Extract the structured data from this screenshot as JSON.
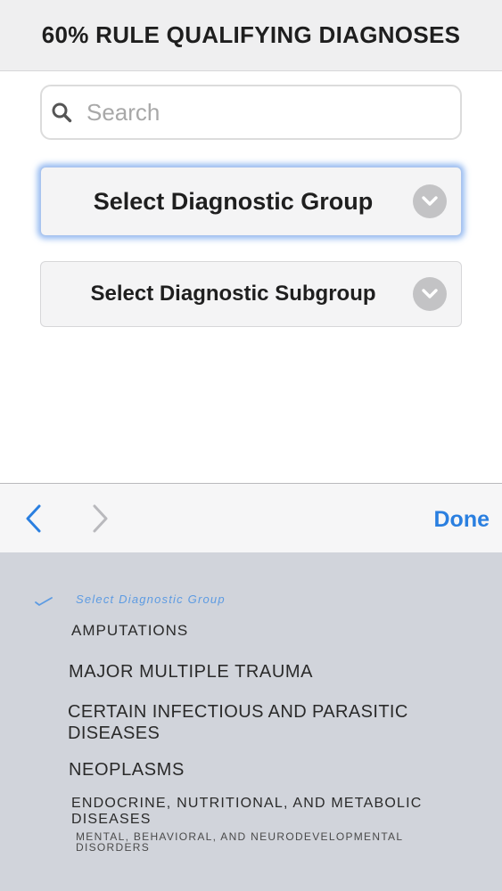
{
  "header": {
    "title": "60% RULE QUALIFYING DIAGNOSES"
  },
  "search": {
    "placeholder": "Search",
    "value": ""
  },
  "group_select": {
    "label": "Select Diagnostic Group"
  },
  "subgroup_select": {
    "label": "Select Diagnostic Subgroup"
  },
  "toolbar": {
    "done_label": "Done"
  },
  "picker": {
    "selected": "Select Diagnostic Group",
    "options": [
      "AMPUTATIONS",
      "MAJOR MULTIPLE TRAUMA",
      "CERTAIN INFECTIOUS AND PARASITIC DISEASES",
      "NEOPLASMS",
      "ENDOCRINE, NUTRITIONAL, AND METABOLIC DISEASES",
      "MENTAL, BEHAVIORAL, AND NEURODEVELOPMENTAL DISORDERS"
    ]
  },
  "colors": {
    "accent": "#2a7fe0",
    "picker_bg": "#d1d4db",
    "header_bg": "#efeff0"
  }
}
